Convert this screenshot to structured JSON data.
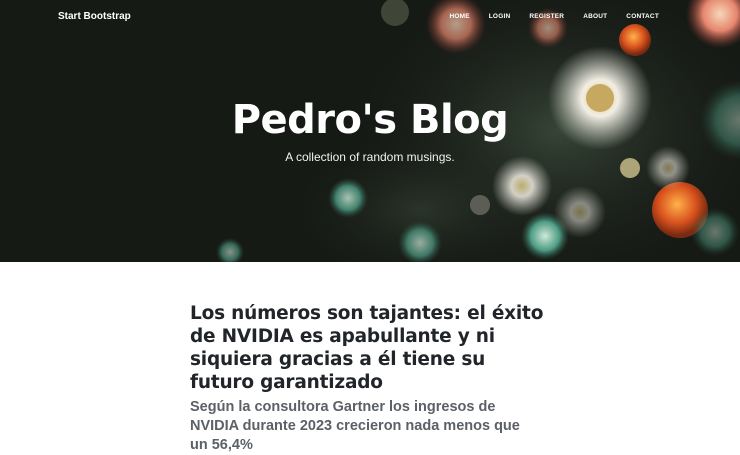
{
  "navbar": {
    "brand": "Start Bootstrap",
    "links": [
      "HOME",
      "LOGIN",
      "REGISTER",
      "ABOUT",
      "CONTACT"
    ]
  },
  "hero": {
    "title": "Pedro's Blog",
    "subtitle": "A collection of random musings."
  },
  "post": {
    "title": "Los números son tajantes: el éxito de NVIDIA es apabullante y ni siquiera gracias a él tiene su futuro garantizado",
    "subtitle": "Según la consultora Gartner los ingresos de NVIDIA durante 2023 crecieron nada menos que un 56,4%"
  },
  "colors": {
    "hero_dark": "#171a16",
    "text_dark": "#212529",
    "text_muted": "#5b6167"
  }
}
